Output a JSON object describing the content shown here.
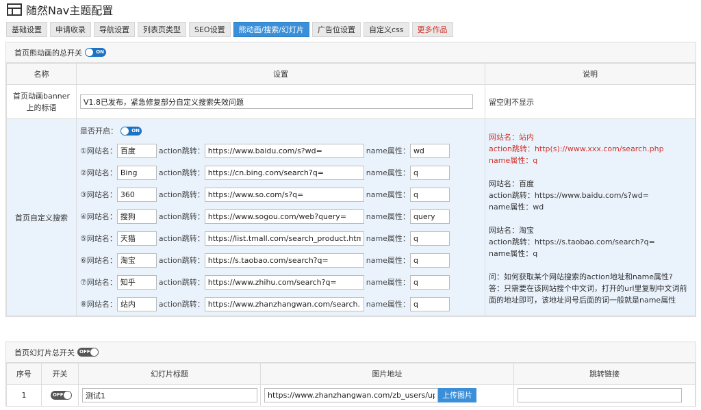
{
  "app": {
    "title": "随然Nav主题配置"
  },
  "tabs": [
    {
      "label": "基础设置"
    },
    {
      "label": "申请收录"
    },
    {
      "label": "导航设置"
    },
    {
      "label": "列表页类型"
    },
    {
      "label": "SEO设置"
    },
    {
      "label": "熊动画/搜索/幻灯片"
    },
    {
      "label": "广告位设置"
    },
    {
      "label": "自定义css"
    },
    {
      "label": "更多作品"
    }
  ],
  "anim_panel": {
    "toggle_label": "首页熊动画的总开关",
    "toggle_state": "ON",
    "columns": {
      "name": "名称",
      "settings": "设置",
      "notes": "说明"
    },
    "banner": {
      "label": "首页动画banner上的标语",
      "value": "V1.8已发布，紧急修复部分自定义搜索失效问题",
      "note": "留空则不显示"
    },
    "search": {
      "label": "首页自定义搜索",
      "enabled_label": "是否开启：",
      "enabled_state": "ON",
      "site_label": "网站名：",
      "action_label": "action跳转：",
      "name_label": "name属性：",
      "rows": [
        {
          "num": "①",
          "site": "百度",
          "action": "https://www.baidu.com/s?wd=",
          "name": "wd"
        },
        {
          "num": "②",
          "site": "Bing",
          "action": "https://cn.bing.com/search?q=",
          "name": "q"
        },
        {
          "num": "③",
          "site": "360",
          "action": "https://www.so.com/s?q=",
          "name": "q"
        },
        {
          "num": "④",
          "site": "搜狗",
          "action": "https://www.sogou.com/web?query=",
          "name": "query"
        },
        {
          "num": "⑤",
          "site": "天猫",
          "action": "https://list.tmall.com/search_product.htm?q=",
          "name": "q"
        },
        {
          "num": "⑥",
          "site": "淘宝",
          "action": "https://s.taobao.com/search?q=",
          "name": "q"
        },
        {
          "num": "⑦",
          "site": "知乎",
          "action": "https://www.zhihu.com/search?q=",
          "name": "q"
        },
        {
          "num": "⑧",
          "site": "站内",
          "action": "https://www.zhanzhangwan.com/search.php?q=",
          "name": "q"
        }
      ],
      "notes": {
        "example1": [
          "网站名：站内",
          "action跳转：http(s)://www.xxx.com/search.php",
          "name属性：q"
        ],
        "example2": [
          "网站名：百度",
          "action跳转：https://www.baidu.com/s?wd=",
          "name属性：wd"
        ],
        "example3": [
          "网站名：淘宝",
          "action跳转：https://s.taobao.com/search?q=",
          "name属性：q"
        ],
        "qa": [
          "问：如何获取某个网站搜索的action地址和name属性?",
          "答：只需要在该网站搜个中文词，打开的url里复制中文词前",
          "面的地址即可，该地址问号后面的词一般就是name属性"
        ]
      }
    }
  },
  "slide_panel": {
    "toggle_label": "首页幻灯片总开关",
    "toggle_state": "OFF",
    "columns": {
      "num": "序号",
      "switch": "开关",
      "title": "幻灯片标题",
      "image": "图片地址",
      "link": "跳转链接"
    },
    "rows": [
      {
        "num": "1",
        "switch": "OFF",
        "title": "测试1",
        "image": "https://www.zhanzhangwan.com/zb_users/upload/",
        "upload_label": "上传图片",
        "link": ""
      }
    ]
  },
  "colors": {
    "accent": "#3a8fd8",
    "toggle_on": "#1d72c4",
    "toggle_off": "#555555",
    "red": "#d0332a",
    "highlight_bg": "#eaf3fc"
  }
}
